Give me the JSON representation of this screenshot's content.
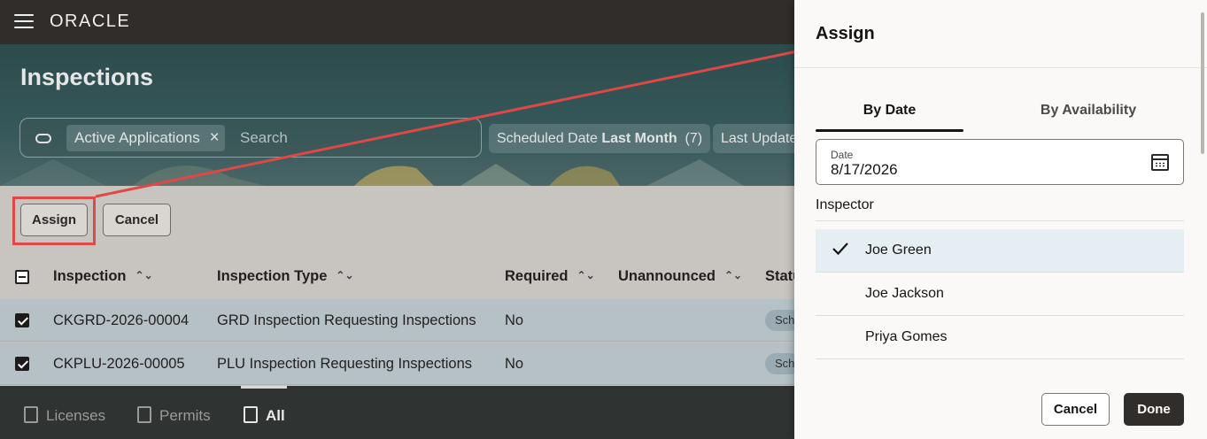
{
  "app": {
    "logo": "ORACLE",
    "page_title": "Inspections"
  },
  "search": {
    "chip_label": "Active Applications",
    "placeholder": "Search",
    "filters": [
      {
        "prefix": "Scheduled Date ",
        "bold": "Last Month",
        "count": "(7)"
      },
      {
        "prefix": "Last Update"
      }
    ]
  },
  "actions": {
    "assign": "Assign",
    "cancel": "Cancel"
  },
  "table": {
    "columns": [
      "Inspection",
      "Inspection Type",
      "Required",
      "Unannounced",
      "Statu"
    ],
    "rows": [
      {
        "inspection": "CKGRD-2026-00004",
        "type": "GRD Inspection Requesting Inspections",
        "required": "No",
        "status": "Sch"
      },
      {
        "inspection": "CKPLU-2026-00005",
        "type": "PLU Inspection Requesting Inspections",
        "required": "No",
        "status": "Sch"
      }
    ]
  },
  "bottom_nav": [
    "Licenses",
    "Permits",
    "All"
  ],
  "drawer": {
    "title": "Assign",
    "tabs": [
      "By Date",
      "By Availability"
    ],
    "date_label": "Date",
    "date_value": "8/17/2026",
    "inspector_label": "Inspector",
    "inspectors": [
      "Joe Green",
      "Joe Jackson",
      "Priya Gomes"
    ],
    "cancel": "Cancel",
    "done": "Done"
  },
  "colors": {
    "annotation": "#e04848",
    "header": "#312d2a",
    "selected_row": "#e4eef3"
  }
}
